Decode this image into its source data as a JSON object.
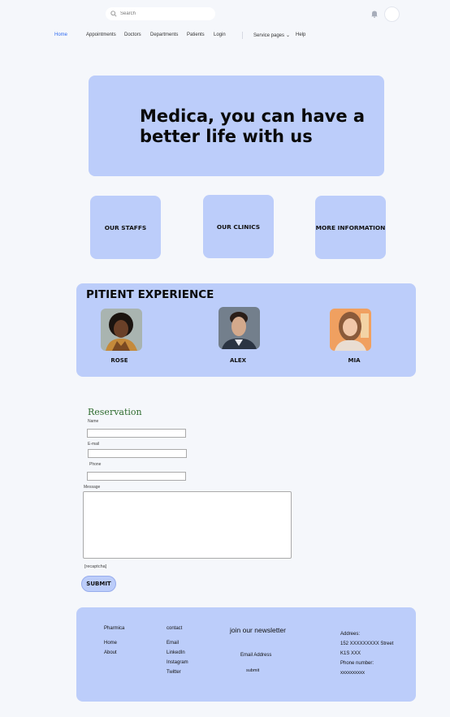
{
  "search": {
    "placeholder": "Search"
  },
  "nav": {
    "items": [
      "Home",
      "Appointments",
      "Doctors",
      "Departments",
      "Patients",
      "Login"
    ],
    "service_pages": "Service pages",
    "help": "Help"
  },
  "hero": {
    "line1": "Medica, you can have a",
    "line2": "better life with us"
  },
  "cards": [
    "OUR STAFFS",
    "OUR CLINICS",
    "MORE INFORMATION"
  ],
  "experience": {
    "title": "PITIENT EXPERIENCE",
    "people": [
      "ROSE",
      "ALEX",
      "MIA"
    ]
  },
  "form": {
    "title": "Reservation",
    "name_label": "Name",
    "email_label": "E-mail",
    "phone_label": "Phone",
    "message_label": "Message",
    "captcha": "[recaptcha]",
    "submit": "SUBMIT"
  },
  "footer": {
    "col1_title": "Pharmica",
    "col1_links": [
      "Home",
      "About"
    ],
    "col2_title": "contact",
    "col2_links": [
      "Email",
      "LinkedIn",
      "Instagram",
      "Twitter"
    ],
    "newsletter_title": "join our newsletter",
    "newsletter_field": "Email Address",
    "newsletter_submit": "submit",
    "address_label": "Addrees:",
    "address_street": "152 XXXXXXXXX Street",
    "address_postal": "K1S XXX",
    "phone_label": "Phone number:",
    "phone_value": "xxxxxxxxxx"
  },
  "colors": {
    "accent": "#bccdfa",
    "nav_active": "#2f6bf0",
    "reservation": "#2e6b2e",
    "background": "#f5f7fb"
  }
}
